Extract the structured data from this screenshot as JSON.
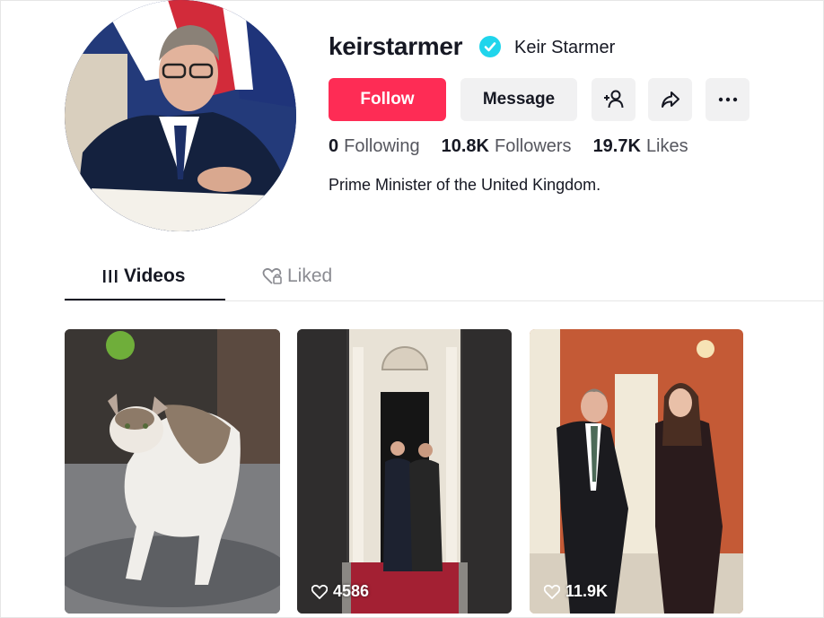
{
  "profile": {
    "username": "keirstarmer",
    "display_name": "Keir Starmer",
    "bio": "Prime Minister of the United Kingdom."
  },
  "actions": {
    "follow_label": "Follow",
    "message_label": "Message"
  },
  "stats": [
    {
      "value": "0",
      "label": "Following"
    },
    {
      "value": "10.8K",
      "label": "Followers"
    },
    {
      "value": "19.7K",
      "label": "Likes"
    }
  ],
  "tabs": {
    "videos": "Videos",
    "liked": "Liked"
  },
  "videos": [
    {
      "views": ""
    },
    {
      "views": "4586"
    },
    {
      "views": "11.9K"
    }
  ],
  "colors": {
    "accent": "#fe2c55",
    "verified": "#20d5ec"
  }
}
